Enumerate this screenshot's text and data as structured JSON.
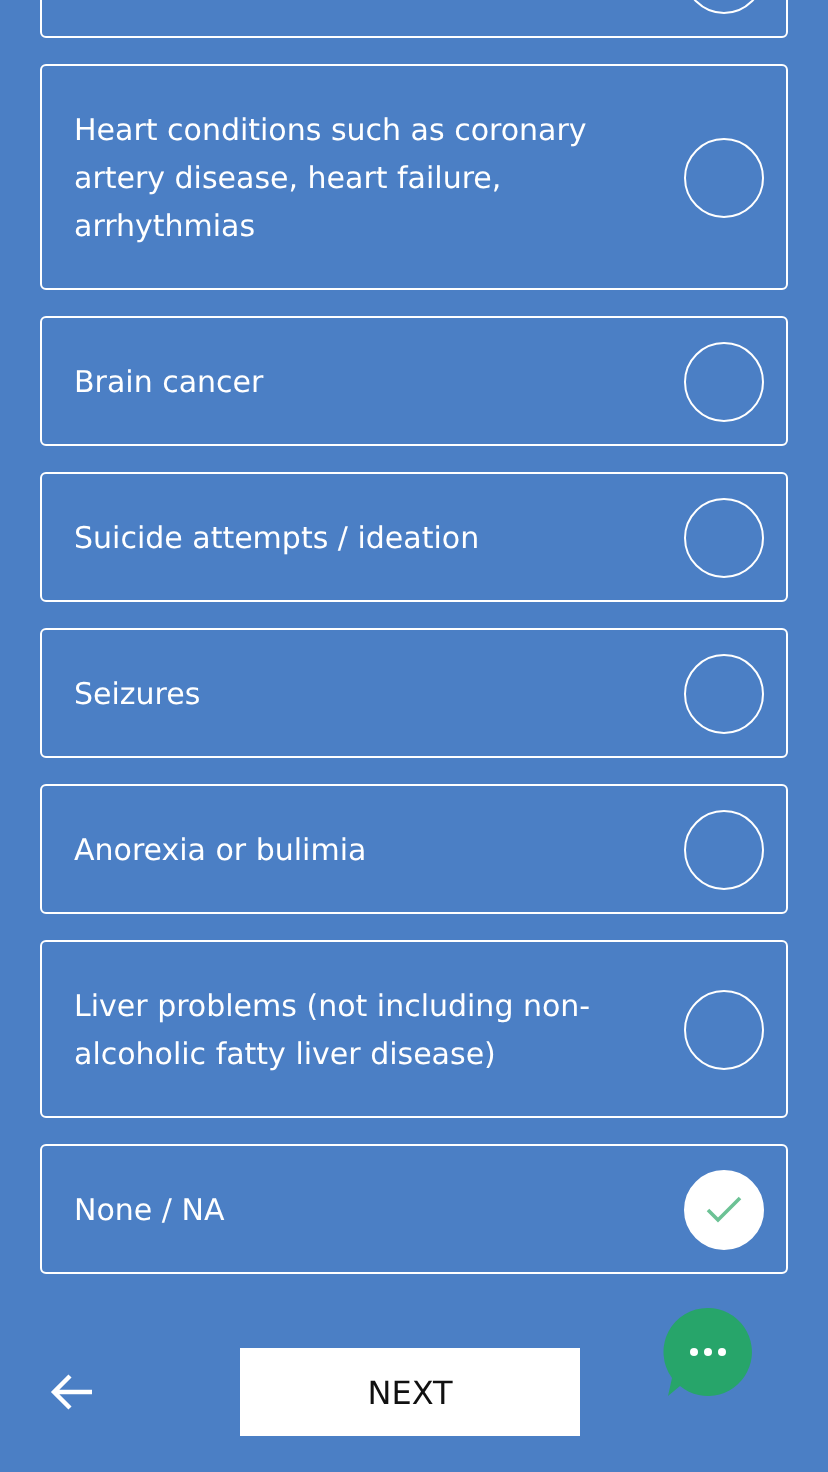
{
  "options": [
    {
      "selected": false
    },
    {
      "label": "Heart conditions such as coronary artery disease, heart failure, arrhythmias",
      "selected": false
    },
    {
      "label": "Brain cancer",
      "selected": false
    },
    {
      "label": "Suicide attempts / ideation",
      "selected": false
    },
    {
      "label": "Seizures",
      "selected": false
    },
    {
      "label": "Anorexia or bulimia",
      "selected": false
    },
    {
      "label": "Liver problems (not including non-alcoholic fatty liver disease)",
      "selected": false
    },
    {
      "label": "None / NA",
      "selected": true
    }
  ],
  "next_button": "NEXT"
}
